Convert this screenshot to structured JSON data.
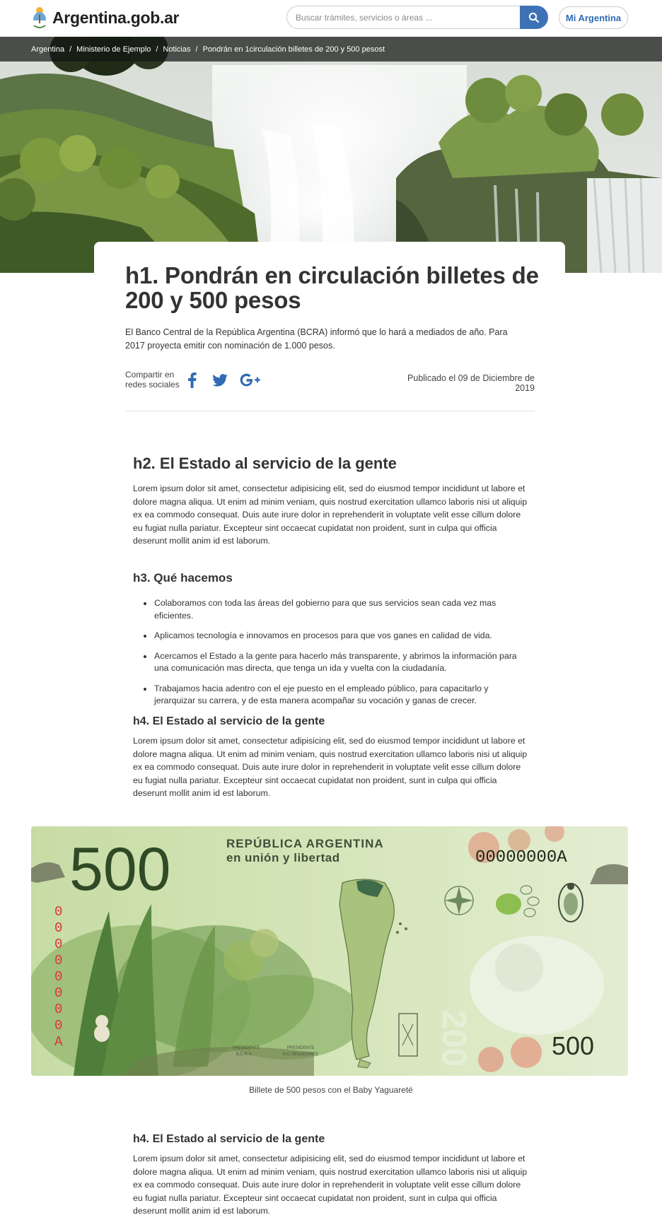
{
  "header": {
    "brand": "Argentina.gob.ar",
    "search_placeholder": "Buscar trámites, servicios o áreas ...",
    "mi_argentina": "Mi Argentina"
  },
  "breadcrumb": [
    "Argentina",
    "Ministerio de Ejemplo",
    "Noticias",
    "Pondrán en 1circulación billetes de 200 y 500 pesost"
  ],
  "article": {
    "title_line1": "h1. Pondrán en circulación billetes de",
    "title_line2": "200 y 500 pesos",
    "lead": "El Banco Central de la República Argentina (BCRA) informó que lo hará a mediados de año. Para 2017 proyecta emitir con nominación de 1.000 pesos.",
    "share_line1": "Compartir en",
    "share_line2": "redes sociales",
    "published": "Publicado el 09 de Diciembre de 2019"
  },
  "section1": {
    "h2": "h2. El Estado al servicio de la gente",
    "text": "Lorem ipsum dolor sit amet, consectetur adipisicing elit, sed do eiusmod tempor incididunt ut labore et dolore magna aliqua. Ut enim ad minim veniam, quis nostrud exercitation ullamco laboris nisi ut aliquip ex ea commodo consequat. Duis aute irure dolor in reprehenderit in voluptate velit esse cillum dolore eu fugiat nulla pariatur. Excepteur sint occaecat cupidatat non proident, sunt in culpa qui officia deserunt mollit anim id est laborum."
  },
  "section2": {
    "h3": "h3. Qué hacemos",
    "items": [
      "Colaboramos con toda las áreas del gobierno para que sus servicios sean cada vez mas eficientes.",
      "Aplicamos tecnología e innovamos en procesos para que vos ganes en calidad de vida.",
      "Acercamos el Estado a la gente para hacerlo más transparente, y abrimos la información para una comunicación mas directa, que tenga un ida y vuelta con la ciudadanía.",
      "Trabajamos hacia adentro con el eje puesto en el empleado público, para capacitarlo y jerarquizar su carrera, y de esta manera acompañar su vocación y ganas de crecer."
    ]
  },
  "section3": {
    "h4": "h4. El Estado al servicio de la gente",
    "text": "Lorem ipsum dolor sit amet, consectetur adipisicing elit, sed do eiusmod tempor incididunt ut labore et dolore magna aliqua. Ut enim ad minim veniam, quis nostrud exercitation ullamco laboris nisi ut aliquip ex ea commodo consequat. Duis aute irure dolor in reprehenderit in voluptate velit esse cillum dolore eu fugiat nulla pariatur. Excepteur sint occaecat cupidatat non proident, sunt in culpa qui officia deserunt mollit anim id est laborum."
  },
  "banknote": {
    "denomination": "500",
    "denomination_small": "500",
    "republic": "REPÚBLICA ARGENTINA",
    "motto": "en unión y libertad",
    "serial": "00000000A",
    "vertical_serial": [
      "0",
      "0",
      "0",
      "0",
      "0",
      "0",
      "0",
      "0",
      "A"
    ],
    "sig1_line1": "PRESIDENTE",
    "sig1_line2": "B.C.R.A.",
    "sig2_line1": "PRESIDENTE",
    "sig2_line2": "H.C.SENADORES",
    "caption": "Billete de 500 pesos con el Baby Yaguareté"
  },
  "section4": {
    "h4": "h4. El Estado al servicio de la gente",
    "text": "Lorem ipsum dolor sit amet, consectetur adipisicing elit, sed do eiusmod tempor incididunt ut labore et dolore magna aliqua. Ut enim ad minim veniam, quis nostrud exercitation ullamco laboris nisi ut aliquip ex ea commodo consequat. Duis aute irure dolor in reprehenderit in voluptate velit esse cillum dolore eu fugiat nulla pariatur. Excepteur sint occaecat cupidatat non proident, sunt in culpa qui officia deserunt mollit anim id est laborum."
  },
  "colors": {
    "primary_blue": "#3e72b6",
    "facebook_blue": "#3b5998",
    "twitter_blue": "#2f6bb3",
    "text": "#333333",
    "note_green": "#cfe3b0",
    "serial_red": "#d9363e"
  },
  "icons": {
    "search": "search-icon",
    "facebook": "facebook-icon",
    "twitter": "twitter-icon",
    "google_plus": "google-plus-icon"
  }
}
